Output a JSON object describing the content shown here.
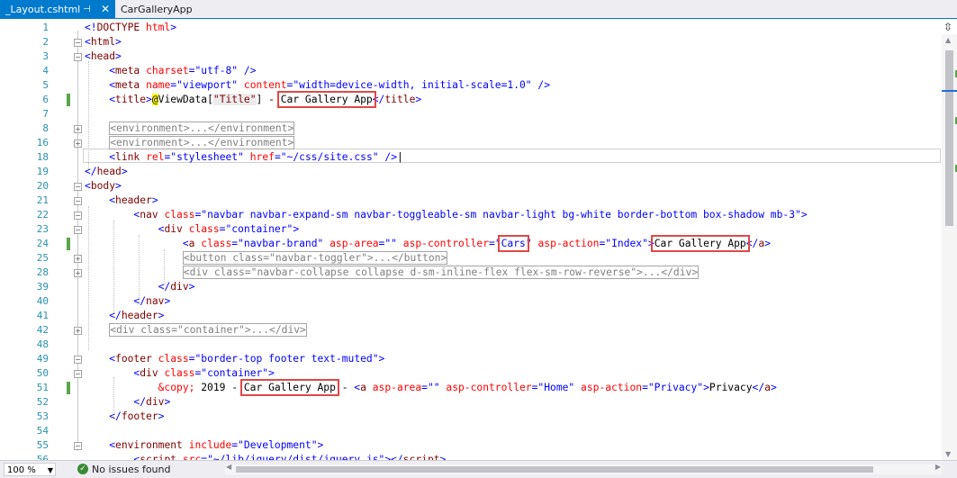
{
  "tabs": [
    {
      "label": "_Layout.cshtml",
      "active": true
    },
    {
      "label": "CarGalleryApp",
      "active": false
    }
  ],
  "editor": {
    "lines": [
      {
        "num": "1"
      },
      {
        "num": "2"
      },
      {
        "num": "3"
      },
      {
        "num": "4"
      },
      {
        "num": "5"
      },
      {
        "num": "6"
      },
      {
        "num": "7"
      },
      {
        "num": "8"
      },
      {
        "num": "16"
      },
      {
        "num": "18"
      },
      {
        "num": "19"
      },
      {
        "num": "20"
      },
      {
        "num": "21"
      },
      {
        "num": "22"
      },
      {
        "num": "23"
      },
      {
        "num": "24"
      },
      {
        "num": "25"
      },
      {
        "num": "28"
      },
      {
        "num": "39"
      },
      {
        "num": "40"
      },
      {
        "num": "41"
      },
      {
        "num": "42"
      },
      {
        "num": "48"
      },
      {
        "num": "49"
      },
      {
        "num": "50"
      },
      {
        "num": "51"
      },
      {
        "num": "52"
      },
      {
        "num": "53"
      },
      {
        "num": "54"
      },
      {
        "num": "55"
      },
      {
        "num": "56"
      }
    ],
    "highlights": {
      "title_text": "Car Gallery App",
      "controller_value": "Cars",
      "brand_text": "Car Gallery App",
      "footer_text": "Car Gallery App"
    }
  },
  "status": {
    "zoom": "100 %",
    "issues": "No issues found"
  },
  "colors": {
    "accent": "#007acc",
    "highlight_box": "#e04848",
    "change_marker": "#57a64a"
  }
}
